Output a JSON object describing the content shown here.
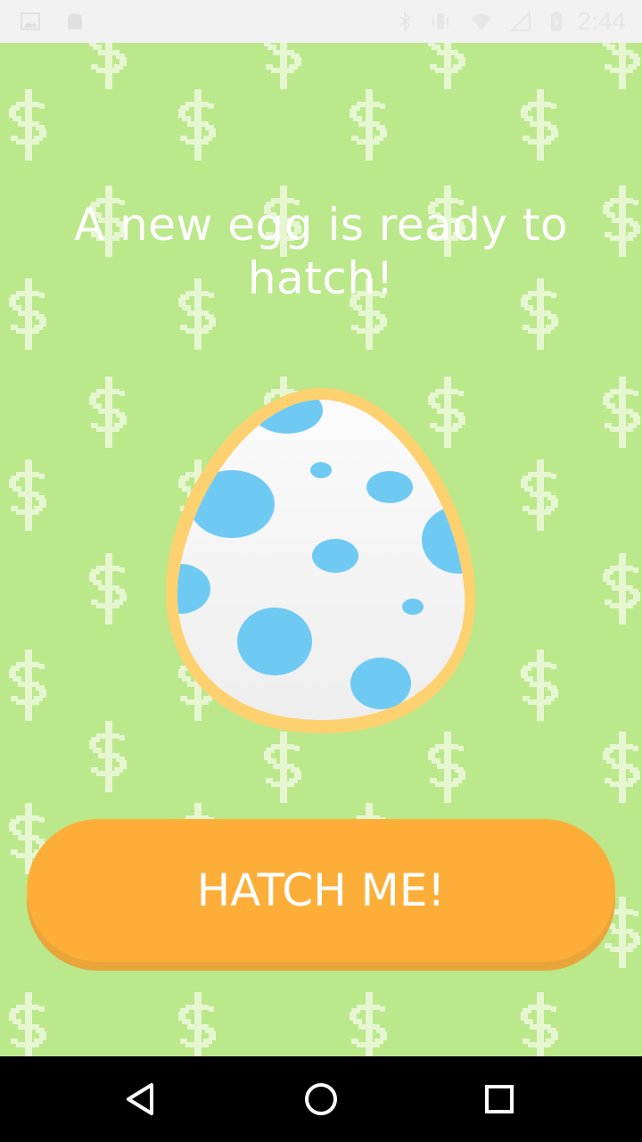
{
  "status_bar": {
    "time": "2:44",
    "left_icons": [
      "image-icon",
      "android-icon"
    ],
    "right_icons": [
      "bluetooth-icon",
      "vibrate-icon",
      "wifi-icon",
      "signal-icon",
      "battery-charging-icon"
    ]
  },
  "content": {
    "heading": "A new egg is ready to hatch!",
    "hatch_button_label": "HATCH ME!"
  },
  "nav_bar": {
    "back": "back-icon",
    "home": "home-icon",
    "recents": "recents-icon"
  },
  "colors": {
    "background": "#bbe88b",
    "pattern": "#e6f6d1",
    "egg_outline": "#fdd16f",
    "egg_spots": "#6fcaf3",
    "button": "#fdae39",
    "button_shadow": "#e9a43a"
  }
}
